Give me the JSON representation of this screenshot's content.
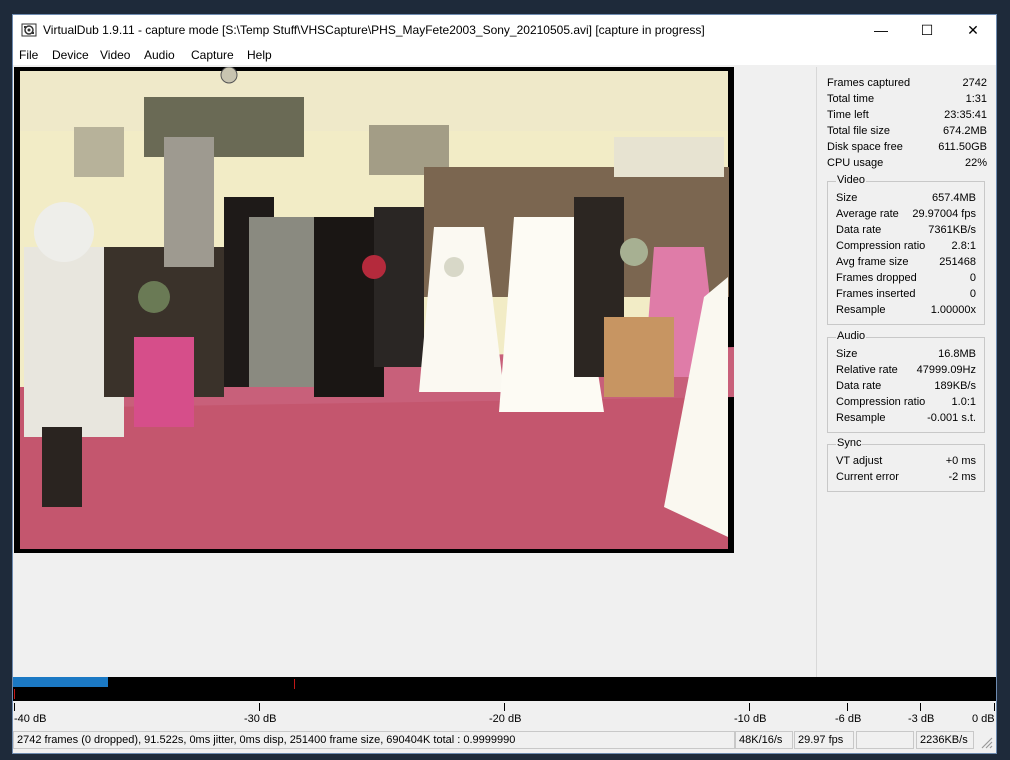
{
  "window": {
    "title": "VirtualDub 1.9.11 - capture mode [S:\\Temp Stuff\\VHSCapture\\PHS_MayFete2003_Sony_20210505.avi] [capture in progress]"
  },
  "titlebar_buttons": {
    "minimize": "—",
    "maximize": "☐",
    "close": "✕"
  },
  "menu": [
    "File",
    "Device",
    "Video",
    "Audio",
    "Capture",
    "Help"
  ],
  "stats": {
    "top": [
      {
        "label": "Frames captured",
        "value": "2742"
      },
      {
        "label": "Total time",
        "value": "1:31"
      },
      {
        "label": "Time left",
        "value": "23:35:41"
      },
      {
        "label": "Total file size",
        "value": "674.2MB"
      },
      {
        "label": "Disk space free",
        "value": "611.50GB"
      },
      {
        "label": "CPU usage",
        "value": "22%"
      }
    ],
    "video": {
      "title": "Video",
      "rows": [
        {
          "label": "Size",
          "value": "657.4MB"
        },
        {
          "label": "Average rate",
          "value": "29.97004 fps"
        },
        {
          "label": "Data rate",
          "value": "7361KB/s"
        },
        {
          "label": "Compression ratio",
          "value": "2.8:1"
        },
        {
          "label": "Avg frame size",
          "value": "251468"
        },
        {
          "label": "Frames dropped",
          "value": "0"
        },
        {
          "label": "Frames inserted",
          "value": "0"
        },
        {
          "label": "Resample",
          "value": "1.00000x"
        }
      ]
    },
    "audio": {
      "title": "Audio",
      "rows": [
        {
          "label": "Size",
          "value": "16.8MB"
        },
        {
          "label": "Relative rate",
          "value": "47999.09Hz"
        },
        {
          "label": "Data rate",
          "value": "189KB/s"
        },
        {
          "label": "Compression ratio",
          "value": "1.0:1"
        },
        {
          "label": "Resample",
          "value": "-0.001 s.t."
        }
      ]
    },
    "sync": {
      "title": "Sync",
      "rows": [
        {
          "label": "VT adjust",
          "value": "+0 ms"
        },
        {
          "label": "Current error",
          "value": "-2 ms"
        }
      ]
    }
  },
  "meter": {
    "level_fraction": 0.097,
    "peak_fraction": 0.286
  },
  "scale_labels": [
    "-40 dB",
    "-30 dB",
    "-20 dB",
    "-10 dB",
    "-6 dB",
    "-3 dB",
    "0 dB"
  ],
  "status": {
    "main": "2742 frames (0 dropped), 91.522s, 0ms jitter, 0ms disp, 251400 frame size, 690404K total : 0.9999990",
    "audio_format": "48K/16/s",
    "fps": "29.97 fps",
    "blank": "",
    "datarate": "2236KB/s"
  },
  "colors": {
    "meter_fill": "#1b79c4",
    "meter_peak": "#c01818",
    "carpet": "#c4566e"
  }
}
